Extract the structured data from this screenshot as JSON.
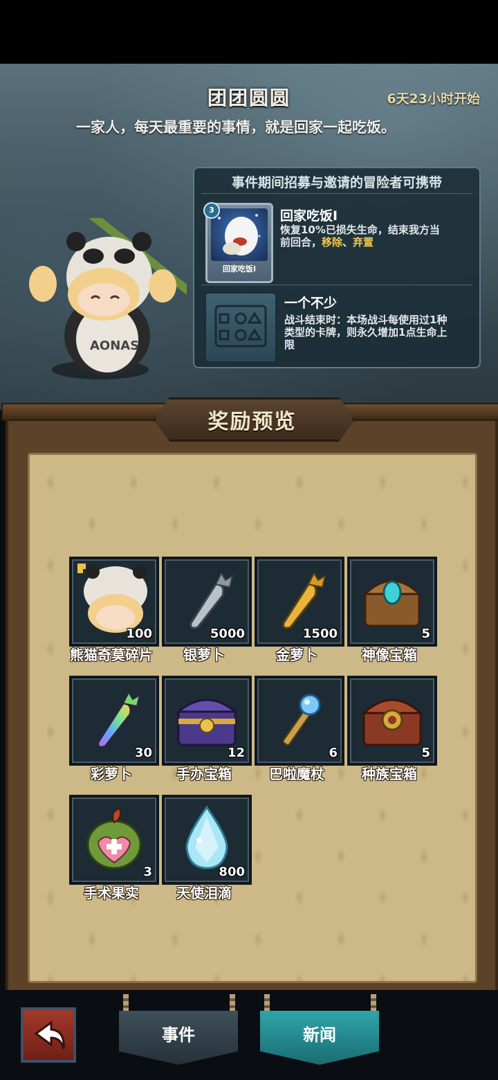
{
  "event": {
    "title": "团团圆圆",
    "countdown": "6天23小时开始",
    "description": "一家人，每天最重要的事情，就是回家一起吃饭。"
  },
  "skills": {
    "header": "事件期间招募与邀请的冒险者可携带",
    "card": {
      "cost": "3",
      "card_label": "回家吃饭I",
      "name": "回家吃饭I",
      "text_line1": "恢复10%已损失生命，结束我方当",
      "text_line2_prefix": "前回合，",
      "keyword_remove": "移除",
      "separator": "、",
      "keyword_discard": "弃置"
    },
    "relic": {
      "name": "一个不少",
      "text_line1": "战斗结束时：本场战斗每使用过1种",
      "text_line2": "类型的卡牌，则永久增加1点生命上",
      "text_line3": "限"
    }
  },
  "board": {
    "title": "奖励预览",
    "rewards": [
      {
        "name": "熊猫奇莫碎片",
        "count": "100",
        "icon": "panda-hero-shard-icon"
      },
      {
        "name": "银萝卜",
        "count": "5000",
        "icon": "silver-carrot-icon"
      },
      {
        "name": "金萝卜",
        "count": "1500",
        "icon": "gold-carrot-icon"
      },
      {
        "name": "神像宝箱",
        "count": "5",
        "icon": "statue-chest-icon"
      },
      {
        "name": "彩萝卜",
        "count": "30",
        "icon": "rainbow-carrot-icon"
      },
      {
        "name": "手办宝箱",
        "count": "12",
        "icon": "figure-chest-icon"
      },
      {
        "name": "巴啦魔杖",
        "count": "6",
        "icon": "magic-wand-icon"
      },
      {
        "name": "种族宝箱",
        "count": "5",
        "icon": "race-chest-icon"
      },
      {
        "name": "手术果实",
        "count": "3",
        "icon": "surgery-fruit-icon"
      },
      {
        "name": "天使泪滴",
        "count": "800",
        "icon": "angel-tear-icon"
      }
    ]
  },
  "nav": {
    "events_tab": "事件",
    "news_tab": "新闻",
    "back_icon": "back-arrow-icon"
  },
  "colors": {
    "accent_teal": "#2fa5a8",
    "highlight_gold": "#f2c94c",
    "back_red": "#a23a2a"
  }
}
